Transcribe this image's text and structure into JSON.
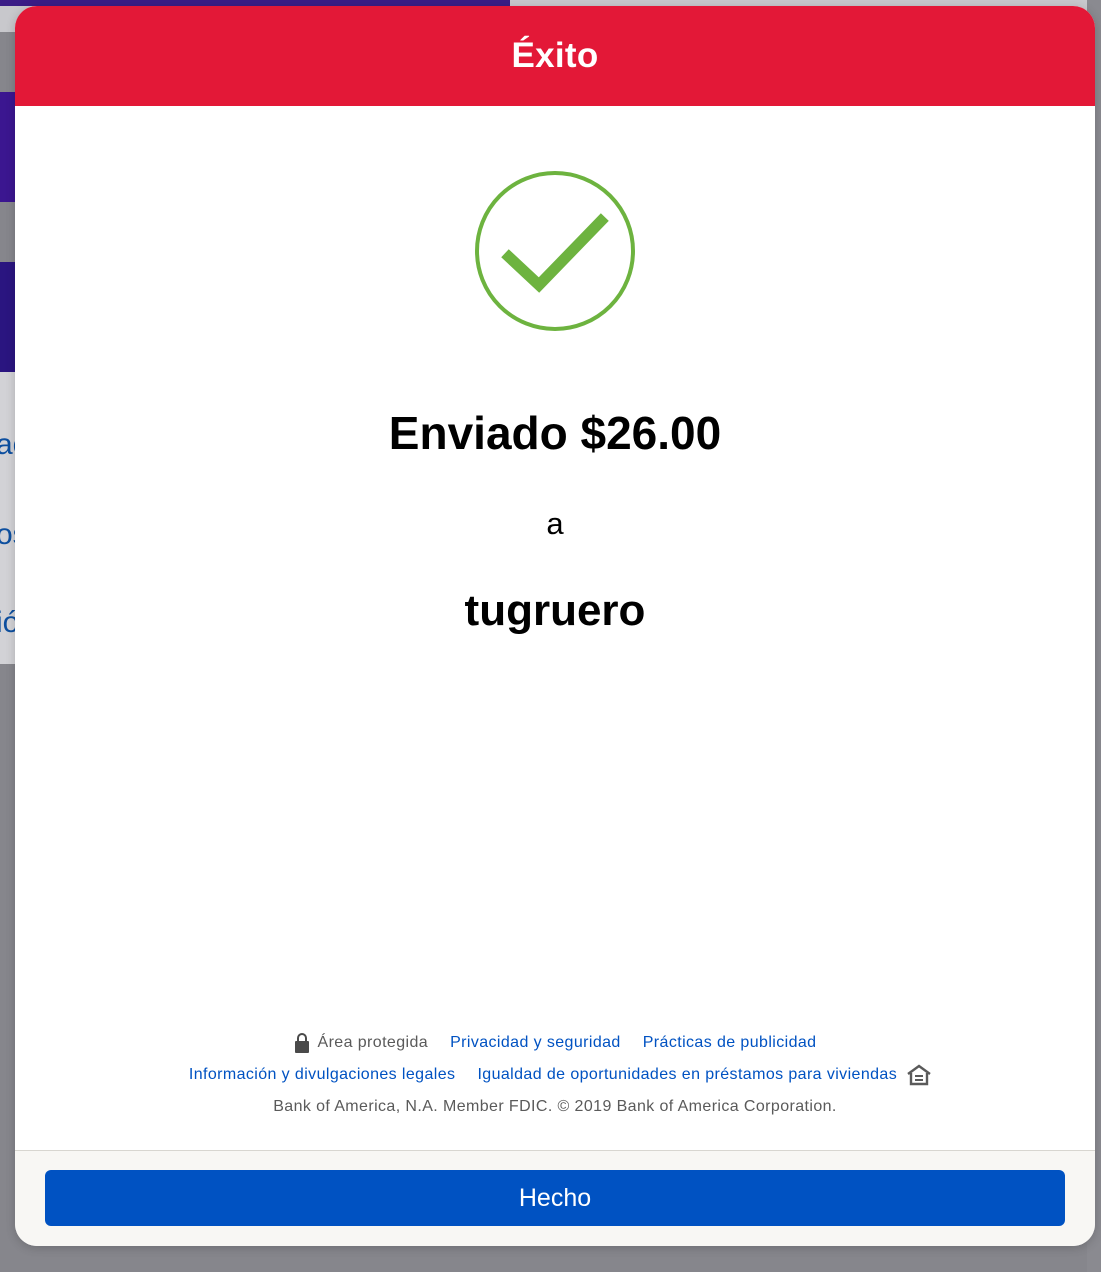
{
  "background": {
    "fragments": [
      "ac",
      "os",
      "ió"
    ]
  },
  "modal": {
    "title": "Éxito",
    "icon": "check-circle-icon",
    "sent_text": "Enviado $26.00",
    "to_text": "a",
    "recipient": "tugruero"
  },
  "footer": {
    "secure_area": "Área protegida",
    "privacy_link": "Privacidad y seguridad",
    "advertising_link": "Prácticas de publicidad",
    "legal_link": "Información y divulgaciones legales",
    "equal_housing_link": "Igualdad de oportunidades en préstamos para viviendas",
    "copyright": "Bank of America, N.A. Member FDIC. © 2019 Bank of America Corporation."
  },
  "actions": {
    "done_label": "Hecho"
  },
  "colors": {
    "header_red": "#e31837",
    "success_green": "#6db33f",
    "link_blue": "#0052c2",
    "button_blue": "#0052c2"
  }
}
